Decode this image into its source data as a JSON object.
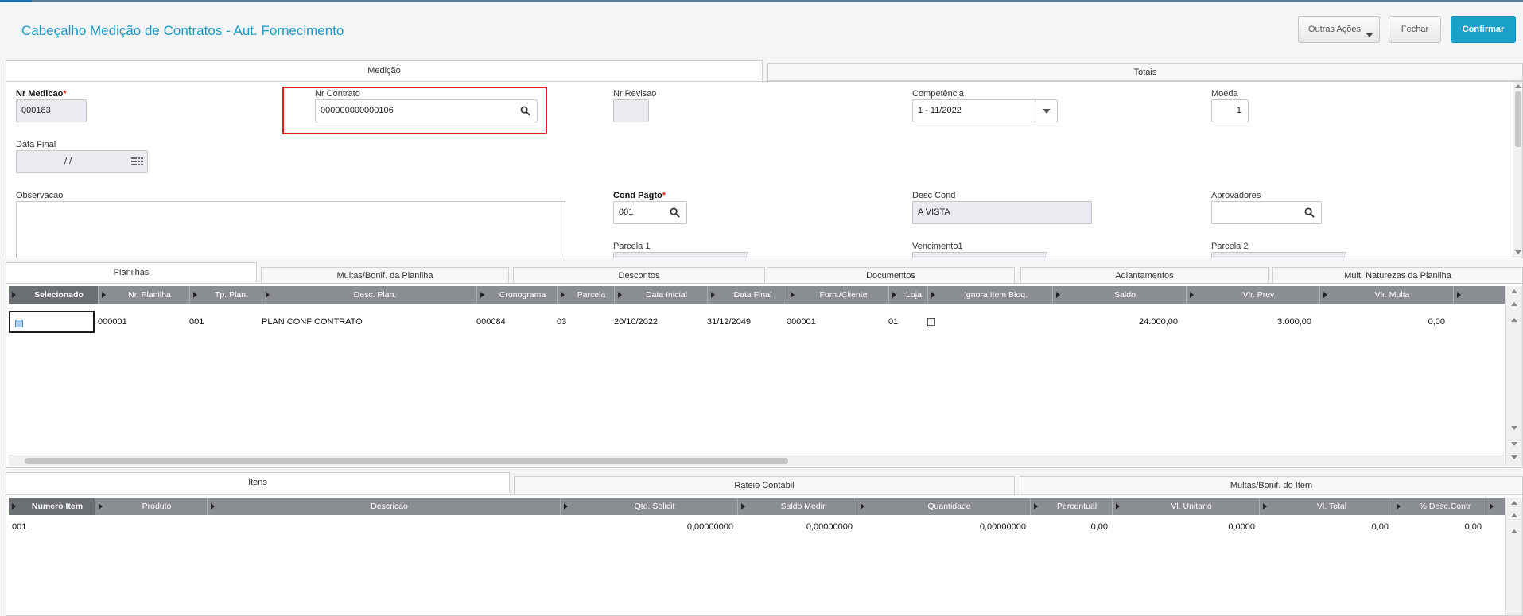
{
  "header": {
    "title": "Cabeçalho Medição de Contratos - Aut. Fornecimento",
    "buttons": {
      "outras": "Outras Ações",
      "fechar": "Fechar",
      "confirmar": "Confirmar"
    }
  },
  "top_tabs": [
    "Medição",
    "Totais"
  ],
  "form": {
    "nr_medicao": {
      "label": "Nr Medicao",
      "value": "000183"
    },
    "nr_contrato": {
      "label": "Nr Contrato",
      "value": "000000000000106"
    },
    "nr_revisao": {
      "label": "Nr Revisao",
      "value": ""
    },
    "competencia": {
      "label": "Competência",
      "value": "1 - 11/2022"
    },
    "moeda": {
      "label": "Moeda",
      "value": "1"
    },
    "data_final": {
      "label": "Data Final",
      "value": "/ /"
    },
    "observacao": {
      "label": "Observacao"
    },
    "cond_pagto": {
      "label": "Cond Pagto",
      "value": "001"
    },
    "desc_cond": {
      "label": "Desc Cond",
      "value": "A VISTA"
    },
    "aprovadores": {
      "label": "Aprovadores",
      "value": ""
    },
    "parcela1": {
      "label": "Parcela 1"
    },
    "vencimento1": {
      "label": "Vencimento1"
    },
    "parcela2": {
      "label": "Parcela 2"
    }
  },
  "mid_tabs": [
    "Planilhas",
    "Multas/Bonif. da Planilha",
    "Descontos",
    "Documentos",
    "Adiantamentos",
    "Mult. Naturezas da Planilha"
  ],
  "planilhas": {
    "headers": [
      "Selecionado",
      "Nr. Planilha",
      "Tp. Plan.",
      "Desc. Plan.",
      "Cronograma",
      "Parcela",
      "Data Inicial",
      "Data Final",
      "Forn./Cliente",
      "Loja",
      "Ignora Item Bloq.",
      "Saldo",
      "Vlr. Prev",
      "Vlr. Multa"
    ],
    "rows": [
      {
        "nr": "000001",
        "tp": "001",
        "desc": "PLAN CONF CONTRATO",
        "crono": "000084",
        "parcela": "03",
        "di": "20/10/2022",
        "df": "31/12/2049",
        "forn": "000001",
        "loja": "01",
        "saldo": "24.000,00",
        "prev": "3.000,00",
        "multa": "0,00"
      }
    ]
  },
  "bottom_tabs": [
    "Itens",
    "Rateio Contabil",
    "Multas/Bonif. do Item"
  ],
  "itens": {
    "headers": [
      "Numero Item",
      "Produto",
      "Descricao",
      "Qtd. Solicit",
      "Saldo Medir",
      "Quantidade",
      "Percentual",
      "Vl. Unitario",
      "Vl. Total",
      "% Desc.Contr"
    ],
    "rows": [
      {
        "num": "001",
        "produto": "",
        "descricao": "",
        "qtd": "0,00000000",
        "saldo": "0,00000000",
        "quant": "0,00000000",
        "perc": "0,00",
        "unit": "0,0000",
        "total": "0,00",
        "desc": "0,00"
      }
    ]
  },
  "colors": {
    "accent": "#1aa0c9",
    "title": "#1a9ac4",
    "highlight": "#e31b23",
    "grid_header": "#8a8e92"
  },
  "icons": [
    "search-icon",
    "calendar-icon",
    "chevron-down-icon"
  ]
}
